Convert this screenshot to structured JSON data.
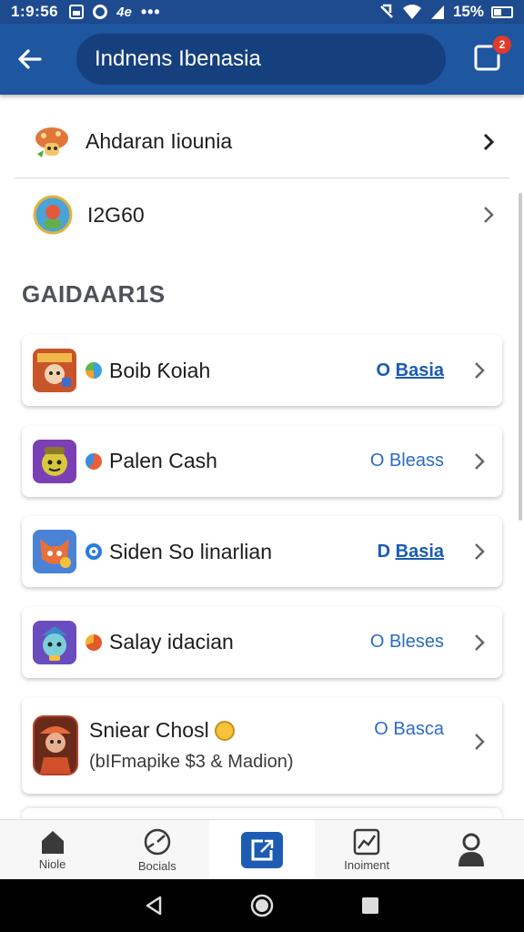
{
  "status_bar": {
    "time": "1:9:56",
    "extra_glyph": "4e",
    "dots": "•••",
    "battery": "15%"
  },
  "header": {
    "search_text": "Indnens Ibenasia",
    "badge_count": "2"
  },
  "top_items": [
    {
      "label": "Ahdaran Iiounia",
      "icon": "mushroom-icon"
    },
    {
      "label": "I2G60",
      "icon": "badge-icon"
    }
  ],
  "section_title": "GAIDAAR1S",
  "cards": [
    {
      "name": "Boib Ƙoiah",
      "status_prefix": "O",
      "status_link": "Basia",
      "dot_color": "#3aa0e0",
      "icon_color": "#c8552a"
    },
    {
      "name": "Palen Cash",
      "status": "O Bleass",
      "dot_color": "#e8603a",
      "icon_color": "#7b3fb5"
    },
    {
      "name": "Siden So linarlian",
      "status_prefix": "D",
      "status_link": "Basia",
      "dot_color": "#2a7ed8",
      "icon_color": "#4a82d8"
    },
    {
      "name": "Salay idacian",
      "status": "O Bleses",
      "dot_color": "#e05a2a",
      "icon_color": "#6a4bc0"
    },
    {
      "name": "Sniear Chosl",
      "status": "O Basca",
      "sub": "(bIFmapike $3 & Madion)",
      "icon_color": "#b3402a"
    }
  ],
  "bottom_nav": [
    {
      "label": "Niole",
      "icon": "home-icon"
    },
    {
      "label": "Bocials",
      "icon": "gauge-icon"
    },
    {
      "label": "",
      "icon": "share-box-icon"
    },
    {
      "label": "Inoiment",
      "icon": "chart-icon"
    },
    {
      "label": "",
      "icon": "profile-icon"
    }
  ],
  "colors": {
    "primary": "#1e56a0",
    "status_bar": "#1e4b8f",
    "link": "#2b6cc4"
  }
}
